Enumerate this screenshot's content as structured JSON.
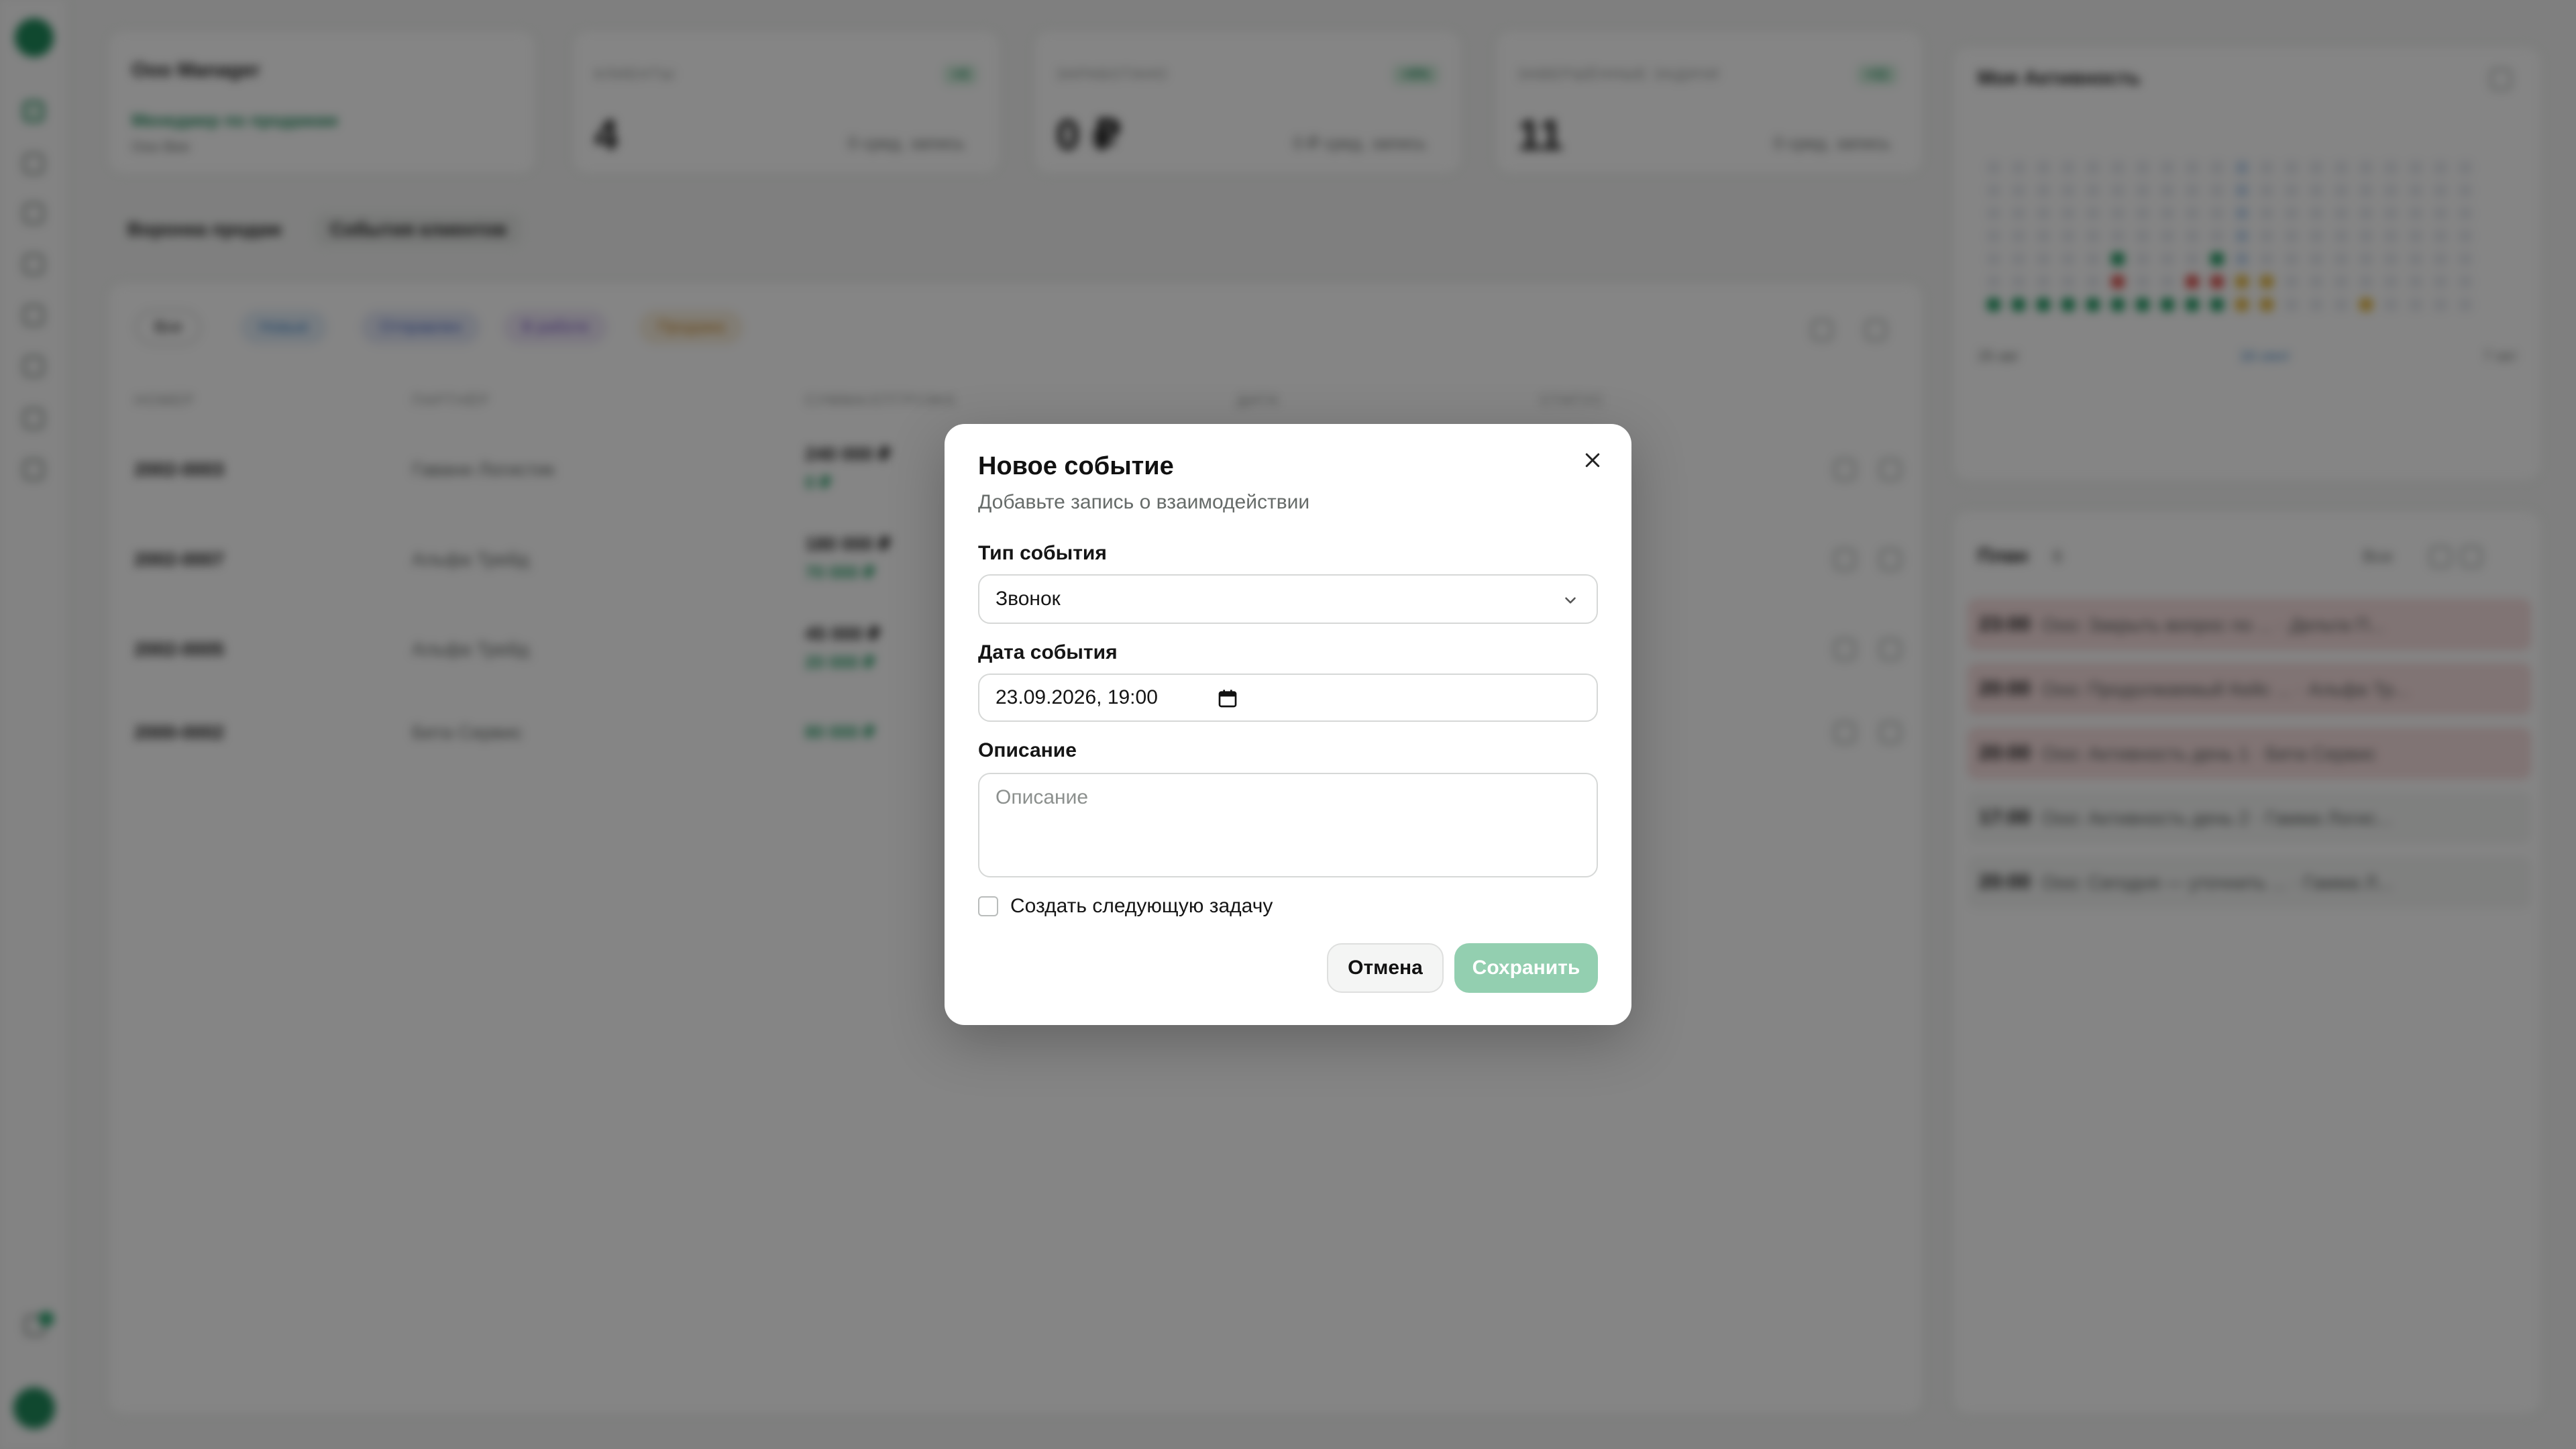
{
  "background": {
    "profile": {
      "title": "Ooo Manager",
      "link": "Менеджер по продажам",
      "sub": "Ooo Bee"
    },
    "stats": [
      {
        "label": "КЛИЕНТЫ",
        "badge": "+4",
        "value": "4",
        "note": "0 сред. запись"
      },
      {
        "label": "ЗАРАБОТАНО",
        "badge": "+0%",
        "value": "0 ₽",
        "note": "0 ₽ сред. запись"
      },
      {
        "label": "ЗАВЕРШЁННЫЕ ЗАДАЧИ",
        "badge": "+11",
        "value": "11",
        "note": "0 сред. запись"
      }
    ],
    "tabs": [
      "Воронка продаж",
      "События клиентов"
    ],
    "filters": [
      "Все",
      "Новые",
      "Отправлен",
      "В работе",
      "Продажа"
    ],
    "table_headers": [
      "НОМЕР",
      "ПАРТНЁР",
      "СУММА/ОТГРУЗКА",
      "ДАТА",
      "СТАТУС"
    ],
    "rows": [
      {
        "id": "2002-0003",
        "partner": "Гавани Логистик",
        "amount": "240 000 ₽",
        "paid": "0 ₽"
      },
      {
        "id": "2002-0007",
        "partner": "Альфа Трейд",
        "amount": "180 000 ₽",
        "paid": "70 000 ₽"
      },
      {
        "id": "2002-0005",
        "partner": "Альфа Трейд",
        "amount": "45 000 ₽",
        "paid": "20 000 ₽"
      },
      {
        "id": "2000-0002",
        "partner": "Бета Сервис",
        "amount": "",
        "paid": "80 000 ₽"
      }
    ],
    "activity": {
      "title": "Моя Активность",
      "axis": [
        "26 авг",
        "16 сент",
        "7 окт"
      ]
    },
    "plans": {
      "title": "План",
      "count": "6",
      "filter": "Все",
      "items": [
        {
          "time": "23:00",
          "text": "Ооо: Закрыть вопрос по ... · Дельта П..."
        },
        {
          "time": "20:00",
          "text": "Ооо: Продолжаемый Кейс ... · Альфа Тр..."
        },
        {
          "time": "20:00",
          "text": "Ооо: Активность день 1 · Бета Сервис"
        },
        {
          "time": "17:00",
          "text": "Ооо: Активность день 2 · Гамма Логис..."
        },
        {
          "time": "20:00",
          "text": "Ооо: Сегодня — уточнить ... · Гамма Л..."
        }
      ]
    }
  },
  "modal": {
    "title": "Новое событие",
    "subtitle": "Добавьте запись о взаимодействии",
    "type_label": "Тип события",
    "type_value": "Звонок",
    "date_label": "Дата события",
    "date_value": "23.09.2026, 19:00",
    "description_label": "Описание",
    "description_placeholder": "Описание",
    "checkbox_label": "Создать следующую задачу",
    "cancel_label": "Отмена",
    "save_label": "Сохранить"
  },
  "colors": {
    "accent": "#1f8a5b",
    "save_disabled": "#93cfb0",
    "overlay": "rgba(0,0,0,0.48)"
  }
}
